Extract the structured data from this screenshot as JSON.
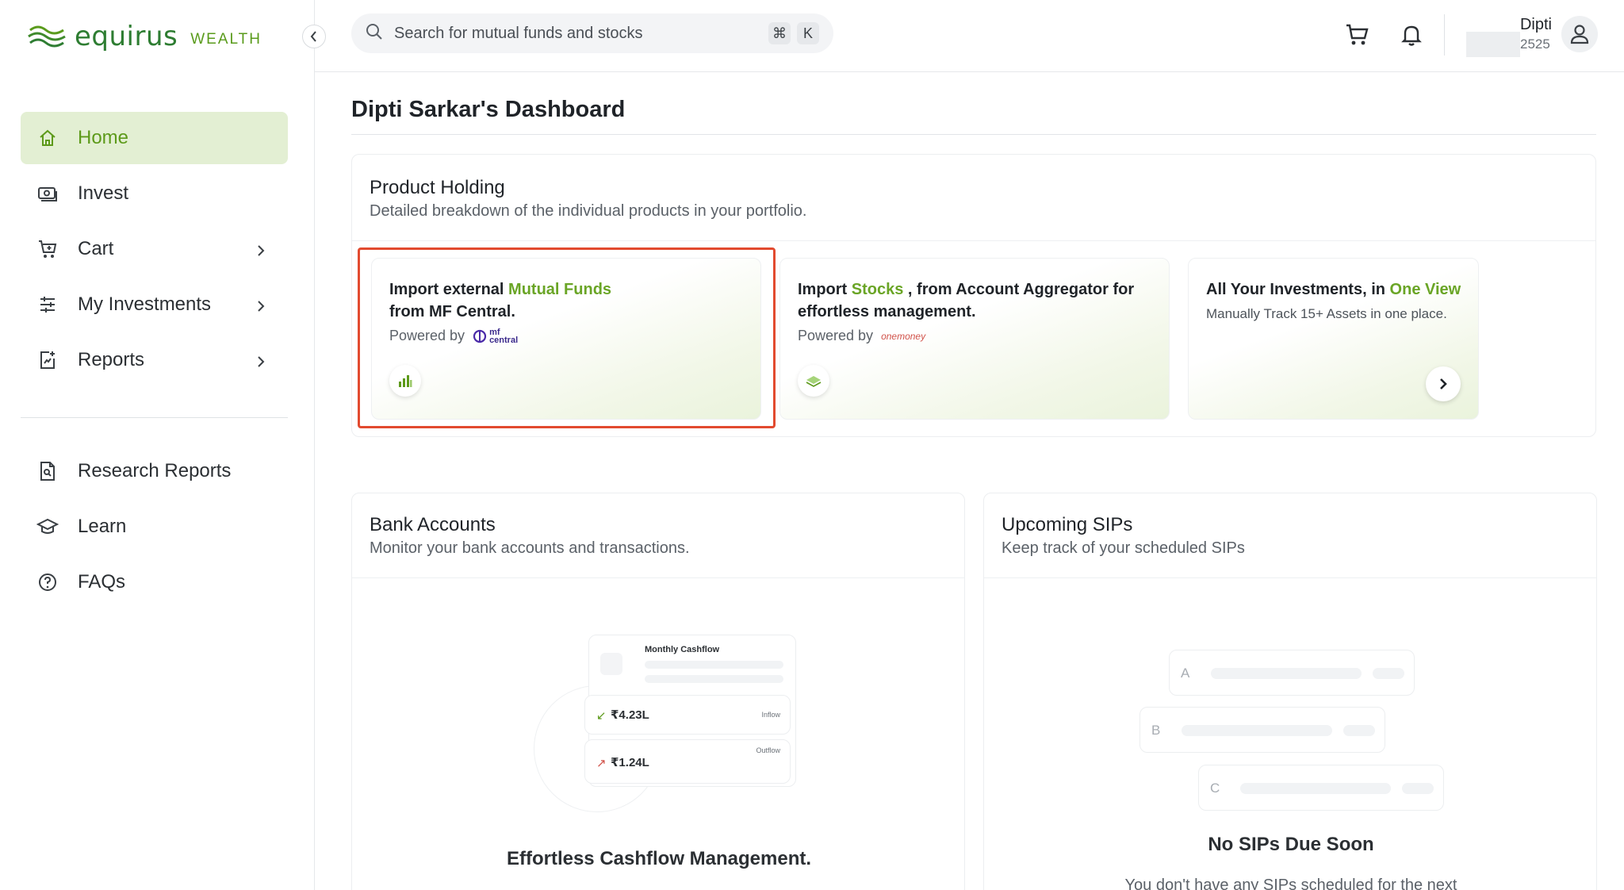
{
  "brand": {
    "name": "equirus",
    "sub": "WEALTH"
  },
  "sidebar": {
    "items": [
      {
        "label": "Home",
        "icon": "home-icon",
        "active": true
      },
      {
        "label": "Invest",
        "icon": "invest-icon"
      },
      {
        "label": "Cart",
        "icon": "cart-icon",
        "has_children": true
      },
      {
        "label": "My Investments",
        "icon": "sliders-icon",
        "has_children": true
      },
      {
        "label": "Reports",
        "icon": "report-icon",
        "has_children": true
      }
    ],
    "secondary": [
      {
        "label": "Research Reports",
        "icon": "research-icon"
      },
      {
        "label": "Learn",
        "icon": "graduation-cap-icon"
      },
      {
        "label": "FAQs",
        "icon": "help-icon"
      }
    ]
  },
  "topbar": {
    "search_placeholder": "Search for mutual funds and stocks",
    "shortcut_keys": [
      "⌘",
      "K"
    ],
    "user": {
      "name": "Dipti",
      "id_suffix": "2525"
    }
  },
  "main": {
    "title": "Dipti Sarkar's Dashboard",
    "product_holding": {
      "title": "Product Holding",
      "subtitle": "Detailed breakdown of the individual products in your portfolio.",
      "tiles": [
        {
          "line1_a": "Import external ",
          "line1_b": "Mutual Funds",
          "line2": "from MF Central.",
          "powered": "Powered by",
          "partner": "mf central"
        },
        {
          "line1_a": "Import ",
          "line1_b": "Stocks",
          "line1_c": " , from Account Aggregator for",
          "line2": "effortless management.",
          "powered": "Powered by",
          "partner": "onemoney"
        },
        {
          "line1_a": "All Your Investments, in ",
          "line1_b": "One View",
          "note": "Manually Track 15+ Assets in one place."
        }
      ]
    },
    "bank_accounts": {
      "title": "Bank Accounts",
      "subtitle": "Monitor your bank accounts and transactions.",
      "illustration": {
        "header": "Monthly Cashflow",
        "inflow_value": "₹4.23L",
        "inflow_label": "Inflow",
        "outflow_value": "₹1.24L",
        "outflow_label": "Outflow"
      },
      "caption": "Effortless Cashflow Management."
    },
    "upcoming_sips": {
      "title": "Upcoming SIPs",
      "subtitle": "Keep track of your scheduled SIPs",
      "rows": [
        "A",
        "B",
        "C"
      ],
      "caption": "No SIPs Due Soon",
      "body": "You don't have any SIPs scheduled for the next"
    }
  },
  "colors": {
    "accent": "#6aa526",
    "active_bg": "#e3efd3",
    "highlight": "#e24a2f"
  }
}
